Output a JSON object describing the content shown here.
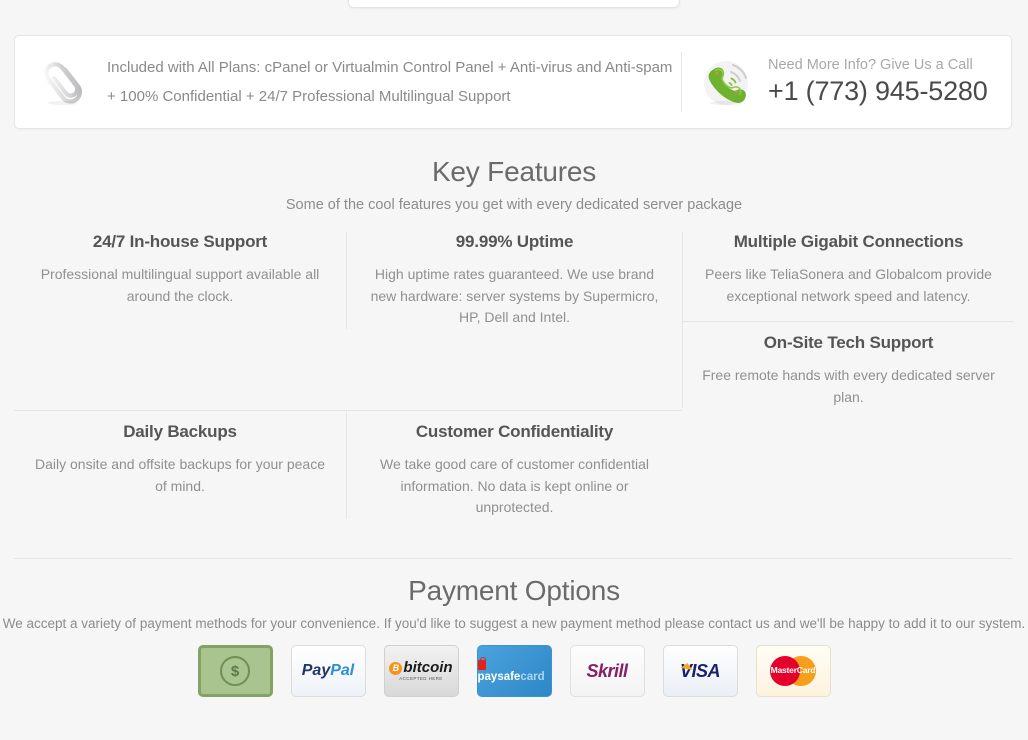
{
  "banner": {
    "clip_icon": "paperclip-icon",
    "text": "Included with All Plans: cPanel or Virtualmin Control Panel + Anti-virus and Anti-spam + 100% Confidential + 24/7 Professional Multilingual Support",
    "phone_icon": "phone-ringing-icon",
    "call_label": "Need More Info? Give Us a Call",
    "call_number": "+1 (773) 945-5280"
  },
  "key_features": {
    "title": "Key Features",
    "subtitle": "Some of the cool features you get with every dedicated server package",
    "items": [
      {
        "title": "24/7 In-house Support",
        "desc": "Professional multilingual support available all around the clock."
      },
      {
        "title": "99.99% Uptime",
        "desc": "High uptime rates guaranteed. We use brand new hardware: server systems by Supermicro, HP, Dell and Intel."
      },
      {
        "title": "Multiple Gigabit Connections",
        "desc": "Peers like TeliaSonera and Globalcom provide exceptional network speed and latency."
      },
      {
        "title": "On-Site Tech Support",
        "desc": "Free remote hands with every dedicated server plan."
      },
      {
        "title": "Daily Backups",
        "desc": "Daily onsite and offsite backups for your peace of mind."
      },
      {
        "title": "Customer Confidentiality",
        "desc": "We take good care of customer confidential information. No data is kept online or unprotected."
      }
    ]
  },
  "payment": {
    "title": "Payment Options",
    "subtitle": "We accept a variety of payment methods for your convenience. If you'd like to suggest a new payment method please contact us and we'll be happy to add it to our system.",
    "methods": [
      {
        "name": "cash-icon",
        "label": "$"
      },
      {
        "name": "paypal-logo",
        "label": "PayPal"
      },
      {
        "name": "bitcoin-logo",
        "label": "bitcoin",
        "sub": "ACCEPTED HERE"
      },
      {
        "name": "paysafecard-logo",
        "label_a": "paysafe",
        "label_b": "card"
      },
      {
        "name": "skrill-logo",
        "label": "Skrill"
      },
      {
        "name": "visa-logo",
        "label": "VISA"
      },
      {
        "name": "mastercard-logo",
        "label": "MasterCard"
      }
    ]
  },
  "colors": {
    "page_bg": "#f6f6f6",
    "card_bg": "#ffffff",
    "border": "#e5e5e5",
    "heading": "#6b6b6b",
    "body_text": "#909090",
    "cash_green": "#a9c48e",
    "paypal_blue": "#20336b",
    "bitcoin_orange": "#f7931a",
    "paysafe_blue": "#3d93cf",
    "skrill_purple": "#862165",
    "visa_navy": "#1a1f71",
    "mastercard_red": "#e4002b",
    "mastercard_orange": "#f79e1b"
  }
}
